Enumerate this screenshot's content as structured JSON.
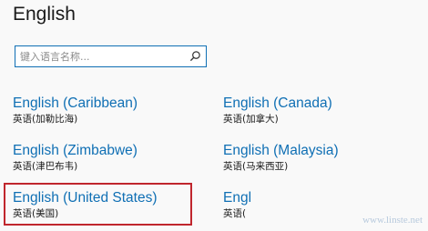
{
  "page": {
    "title": "English"
  },
  "search": {
    "placeholder": "键入语言名称..."
  },
  "languages": [
    {
      "name": "English (Caribbean)",
      "native": "英语(加勒比海)"
    },
    {
      "name": "English (Canada)",
      "native": "英语(加拿大)"
    },
    {
      "name": "English (Zimbabwe)",
      "native": "英语(津巴布韦)"
    },
    {
      "name": "English (Malaysia)",
      "native": "英语(马来西亚)"
    },
    {
      "name": "English (United States)",
      "native": "英语(美国)"
    },
    {
      "name": "Engl",
      "native": "英语("
    }
  ],
  "watermark": "www.linste.net",
  "colors": {
    "accent": "#0f6fb4",
    "highlight": "#c0262d"
  }
}
